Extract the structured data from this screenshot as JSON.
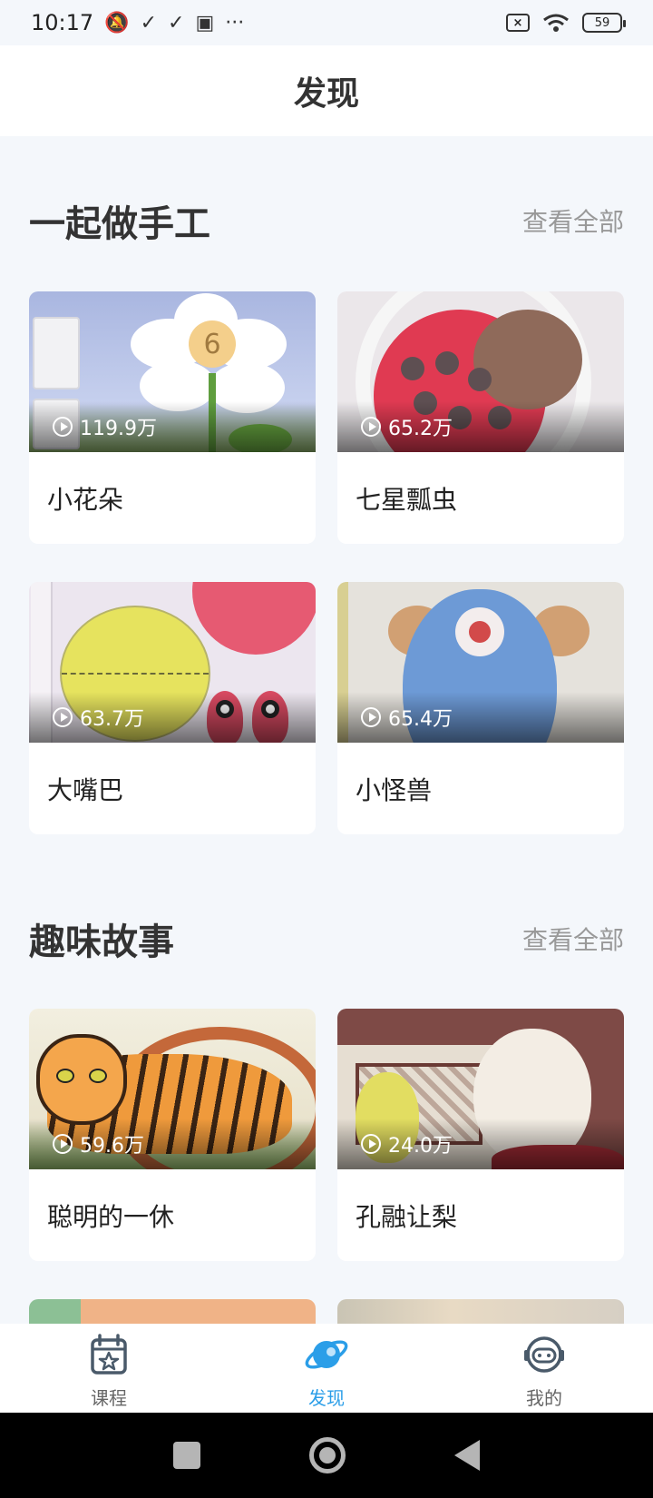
{
  "status_bar": {
    "time": "10:17",
    "battery": "59",
    "icons": [
      "mute-icon",
      "check-icon",
      "check-icon",
      "image-icon",
      "more-dots-icon",
      "sim-x-icon",
      "wifi-icon",
      "battery-icon"
    ]
  },
  "header": {
    "title": "发现"
  },
  "sections": [
    {
      "title": "一起做手工",
      "view_all": "查看全部",
      "items": [
        {
          "title": "小花朵",
          "views": "119.9万"
        },
        {
          "title": "七星瓢虫",
          "views": "65.2万"
        },
        {
          "title": "大嘴巴",
          "views": "63.7万"
        },
        {
          "title": "小怪兽",
          "views": "65.4万"
        }
      ]
    },
    {
      "title": "趣味故事",
      "view_all": "查看全部",
      "items": [
        {
          "title": "聪明的一休",
          "views": "59.6万"
        },
        {
          "title": "孔融让梨",
          "views": "24.0万"
        }
      ]
    }
  ],
  "tab_bar": {
    "tabs": [
      {
        "label": "课程",
        "icon": "calendar-star-icon",
        "active": false
      },
      {
        "label": "发现",
        "icon": "planet-icon",
        "active": true
      },
      {
        "label": "我的",
        "icon": "robot-head-icon",
        "active": false
      }
    ],
    "active_color": "#2b9ee8"
  },
  "theme": {
    "background": "#f4f7fb",
    "card": "#ffffff",
    "text": "#222222",
    "muted": "#999999"
  }
}
